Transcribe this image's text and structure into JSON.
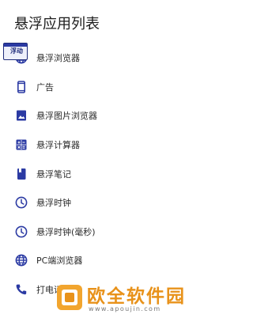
{
  "header": {
    "title": "悬浮应用列表"
  },
  "float_badge": {
    "label": "浮动"
  },
  "accent_color": "#2b3aa3",
  "apps": [
    {
      "label": "悬浮浏览器",
      "icon": "globe-icon"
    },
    {
      "label": "广告",
      "icon": "phone-icon"
    },
    {
      "label": "悬浮图片浏览器",
      "icon": "image-icon"
    },
    {
      "label": "悬浮计算器",
      "icon": "calculator-icon"
    },
    {
      "label": "悬浮笔记",
      "icon": "note-book-icon"
    },
    {
      "label": "悬浮时钟",
      "icon": "clock-icon"
    },
    {
      "label": "悬浮时钟(毫秒)",
      "icon": "clock-icon"
    },
    {
      "label": "PC端浏览器",
      "icon": "globe-icon"
    },
    {
      "label": "打电话",
      "icon": "call-icon"
    }
  ],
  "watermark": {
    "text": "欧全软件园",
    "url": "www.apoujin.com",
    "color": "#e8921a"
  }
}
